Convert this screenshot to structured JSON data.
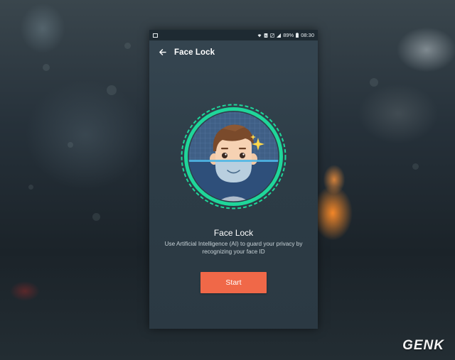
{
  "statusbar": {
    "battery": "89%",
    "time": "08:30"
  },
  "appbar": {
    "title": "Face Lock"
  },
  "main": {
    "title": "Face Lock",
    "description_line1": "Use Artificial Intelligence (AI) to guard your privacy by",
    "description_line2": "recognizing your face ID",
    "start_label": "Start"
  },
  "watermark": "GENK",
  "colors": {
    "accent_ring": "#1fd69a",
    "button": "#f06848",
    "appbar": "#34444f"
  },
  "icons": [
    "image-icon",
    "wifi-icon",
    "nfc-icon",
    "no-sim-icon",
    "signal-icon",
    "battery-icon",
    "back-arrow-icon",
    "face-avatar-icon",
    "sparkle-icon"
  ]
}
